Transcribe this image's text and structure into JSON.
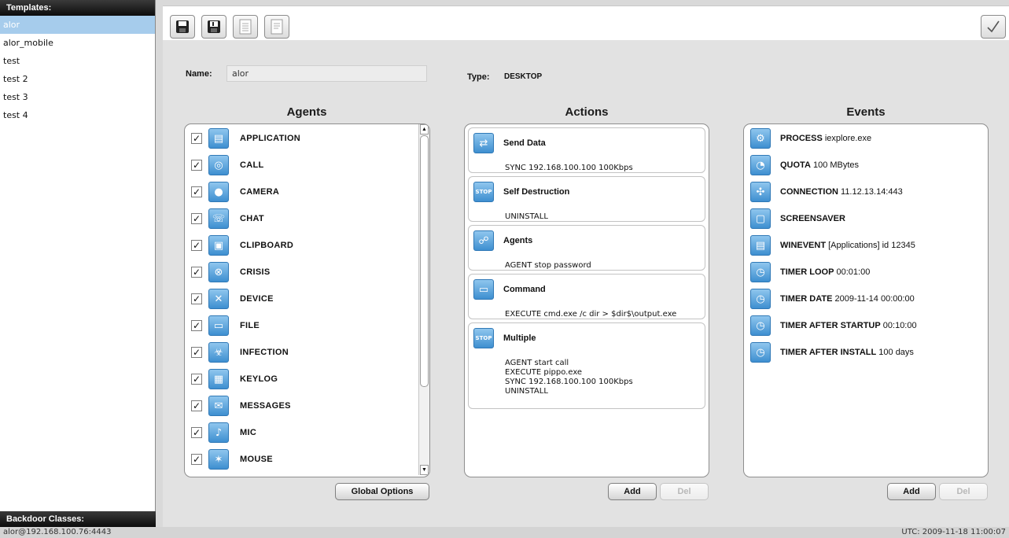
{
  "templates": {
    "header": "Templates:",
    "items": [
      "alor",
      "alor_mobile",
      "test",
      "test 2",
      "test 3",
      "test 4"
    ],
    "selected": "alor"
  },
  "backdoor_classes": {
    "header": "Backdoor Classes:"
  },
  "toolbar": {
    "buttons": [
      "save-icon",
      "save-as-icon",
      "new-document-icon",
      "document-icon"
    ],
    "apply_icon": "checkmark-icon"
  },
  "form": {
    "name_label": "Name:",
    "name_value": "alor",
    "type_label": "Type:",
    "type_value": "DESKTOP"
  },
  "agents": {
    "title": "Agents",
    "items": [
      {
        "name": "APPLICATION",
        "checked": true,
        "icon": "application-icon"
      },
      {
        "name": "CALL",
        "checked": true,
        "icon": "call-icon"
      },
      {
        "name": "CAMERA",
        "checked": true,
        "icon": "camera-icon"
      },
      {
        "name": "CHAT",
        "checked": true,
        "icon": "chat-icon"
      },
      {
        "name": "CLIPBOARD",
        "checked": true,
        "icon": "clipboard-icon"
      },
      {
        "name": "CRISIS",
        "checked": true,
        "icon": "crisis-icon"
      },
      {
        "name": "DEVICE",
        "checked": true,
        "icon": "device-icon"
      },
      {
        "name": "FILE",
        "checked": true,
        "icon": "file-icon"
      },
      {
        "name": "INFECTION",
        "checked": true,
        "icon": "infection-icon"
      },
      {
        "name": "KEYLOG",
        "checked": true,
        "icon": "keylog-icon"
      },
      {
        "name": "MESSAGES",
        "checked": true,
        "icon": "messages-icon"
      },
      {
        "name": "MIC",
        "checked": true,
        "icon": "mic-icon"
      },
      {
        "name": "MOUSE",
        "checked": true,
        "icon": "mouse-icon"
      }
    ],
    "global_options_label": "Global Options"
  },
  "actions": {
    "title": "Actions",
    "items": [
      {
        "title": "Send Data",
        "icon": "send-data-icon",
        "lines": [
          "SYNC 192.168.100.100 100Kbps"
        ]
      },
      {
        "title": "Self Destruction",
        "icon": "stop-icon",
        "lines": [
          "UNINSTALL"
        ]
      },
      {
        "title": "Agents",
        "icon": "agents-icon",
        "lines": [
          "AGENT stop password"
        ]
      },
      {
        "title": "Command",
        "icon": "command-icon",
        "lines": [
          "EXECUTE cmd.exe /c dir > $dir$\\output.exe"
        ]
      },
      {
        "title": "Multiple",
        "icon": "stop-icon",
        "lines": [
          "AGENT start call",
          "EXECUTE pippo.exe",
          "SYNC 192.168.100.100 100Kbps",
          "UNINSTALL"
        ]
      }
    ],
    "add_label": "Add",
    "del_label": "Del"
  },
  "events": {
    "title": "Events",
    "items": [
      {
        "type": "PROCESS",
        "detail": "iexplore.exe",
        "icon": "process-icon"
      },
      {
        "type": "QUOTA",
        "detail": "100 MBytes",
        "icon": "quota-icon"
      },
      {
        "type": "CONNECTION",
        "detail": "11.12.13.14:443",
        "icon": "connection-icon"
      },
      {
        "type": "SCREENSAVER",
        "detail": "",
        "icon": "screensaver-icon"
      },
      {
        "type": "WINEVENT",
        "detail": "[Applications] id 12345",
        "icon": "winevent-icon"
      },
      {
        "type": "TIMER LOOP",
        "detail": "00:01:00",
        "icon": "clock-icon"
      },
      {
        "type": "TIMER DATE",
        "detail": "2009-11-14 00:00:00",
        "icon": "clock-icon"
      },
      {
        "type": "TIMER AFTER STARTUP",
        "detail": "00:10:00",
        "icon": "clock-icon"
      },
      {
        "type": "TIMER AFTER INSTALL",
        "detail": "100 days",
        "icon": "clock-icon"
      }
    ],
    "add_label": "Add",
    "del_label": "Del"
  },
  "statusbar": {
    "connection": "alor@192.168.100.76:4443",
    "utc": "UTC: 2009-11-18 11:00:07"
  },
  "colors": {
    "selection": "#a6ccec",
    "header_bg": "#111111",
    "icon_blue": "#4a9ad8"
  }
}
